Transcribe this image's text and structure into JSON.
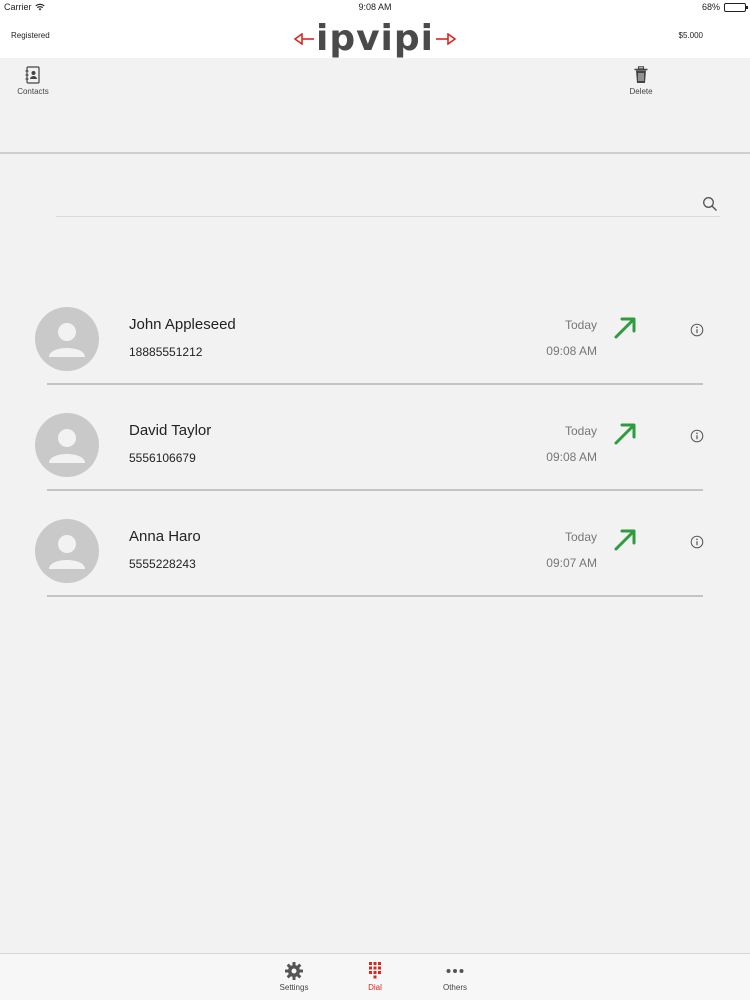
{
  "status_bar": {
    "carrier": "Carrier",
    "time": "9:08 AM",
    "battery": "68%",
    "battery_level": 0.68
  },
  "header": {
    "registration_status": "Registered",
    "balance": "$5.000",
    "logo_text": "ipvipi",
    "logo_arrow_color": "#d9281f"
  },
  "toolbar": {
    "contacts_label": "Contacts",
    "delete_label": "Delete"
  },
  "search": {
    "value": "",
    "placeholder": ""
  },
  "calls": [
    {
      "name": "John Appleseed",
      "number": "18885551212",
      "day": "Today",
      "time": "09:08 AM",
      "direction": "outgoing"
    },
    {
      "name": "David Taylor",
      "number": "5556106679",
      "day": "Today",
      "time": "09:08 AM",
      "direction": "outgoing"
    },
    {
      "name": "Anna Haro",
      "number": "5555228243",
      "day": "Today",
      "time": "09:07 AM",
      "direction": "outgoing"
    }
  ],
  "tabs": [
    {
      "label": "Settings",
      "icon": "gear-icon",
      "active": false
    },
    {
      "label": "Dial",
      "icon": "dialpad-icon",
      "active": true
    },
    {
      "label": "Others",
      "icon": "more-dots-icon",
      "active": false
    }
  ],
  "colors": {
    "accent": "#d9281f",
    "outgoing_arrow": "#2e9b3e",
    "avatar_bg": "#c9c9c9"
  }
}
